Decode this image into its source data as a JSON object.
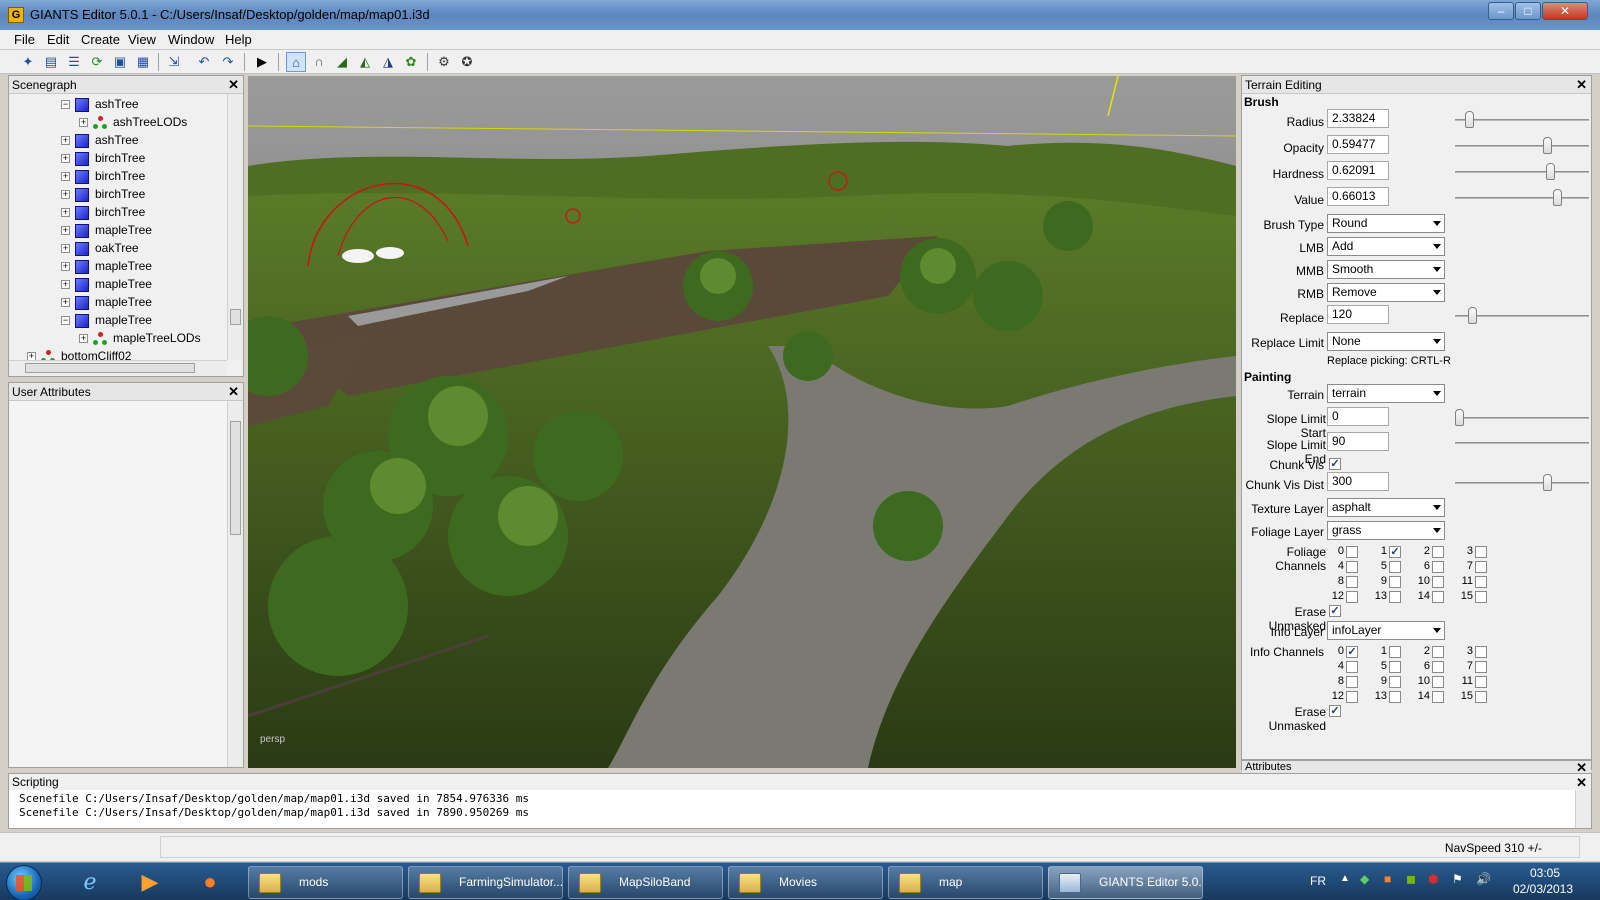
{
  "window": {
    "title": "GIANTS Editor 5.0.1 - C:/Users/Insaf/Desktop/golden/map/map01.i3d",
    "buttons": [
      "–",
      "□",
      "✕"
    ]
  },
  "menu": [
    "File",
    "Edit",
    "Create",
    "View",
    "Window",
    "Help"
  ],
  "toolbar": {
    "icons": [
      "new-icon",
      "open-icon",
      "list-icon",
      "refresh-icon",
      "save-icon",
      "save-all-icon",
      "import-icon",
      "undo-icon",
      "redo-icon",
      "play-icon",
      "select-icon",
      "move-icon",
      "terrain-sculpt-icon",
      "terrain-paint-icon",
      "terrain-texture-icon",
      "foliage-icon",
      "gear-icon",
      "gear-settings-icon"
    ]
  },
  "scenegraph": {
    "title": "Scenegraph",
    "items": [
      {
        "label": "ashTree",
        "type": "node",
        "expanded": true
      },
      {
        "label": "ashTreeLODs",
        "type": "lod",
        "expanded": false
      },
      {
        "label": "ashTree",
        "type": "node",
        "expanded": false
      },
      {
        "label": "birchTree",
        "type": "node",
        "expanded": false
      },
      {
        "label": "birchTree",
        "type": "node",
        "expanded": false
      },
      {
        "label": "birchTree",
        "type": "node",
        "expanded": false
      },
      {
        "label": "birchTree",
        "type": "node",
        "expanded": false
      },
      {
        "label": "mapleTree",
        "type": "node",
        "expanded": false
      },
      {
        "label": "oakTree",
        "type": "node",
        "expanded": false
      },
      {
        "label": "mapleTree",
        "type": "node",
        "expanded": false
      },
      {
        "label": "mapleTree",
        "type": "node",
        "expanded": false
      },
      {
        "label": "mapleTree",
        "type": "node",
        "expanded": false
      },
      {
        "label": "mapleTree",
        "type": "node",
        "expanded": true
      },
      {
        "label": "mapleTreeLODs",
        "type": "lod",
        "expanded": false
      },
      {
        "label": "bottomCliff02",
        "type": "lod",
        "expanded": false
      }
    ]
  },
  "user_attributes": {
    "title": "User Attributes"
  },
  "viewport": {
    "camera_label": "persp"
  },
  "terrain_editing": {
    "title": "Terrain Editing",
    "brush": {
      "section": "Brush",
      "radius_label": "Radius",
      "radius": "2.33824",
      "radius_level": 0.08,
      "opacity_label": "Opacity",
      "opacity": "0.59477",
      "opacity_level": 0.7,
      "hardness_label": "Hardness",
      "hardness": "0.62091",
      "hardness_level": 0.73,
      "value_label": "Value",
      "value": "0.66013",
      "value_level": 0.78,
      "brush_type_label": "Brush Type",
      "brush_type": "Round",
      "lmb_label": "LMB",
      "lmb": "Add",
      "mmb_label": "MMB",
      "mmb": "Smooth",
      "rmb_label": "RMB",
      "rmb": "Remove",
      "replace_label": "Replace",
      "replace": "120",
      "replace_level": 0.1,
      "replace_limit_label": "Replace Limit",
      "replace_limit": "None",
      "replace_picking": "Replace picking: CRTL-R"
    },
    "painting": {
      "section": "Painting",
      "terrain_label": "Terrain",
      "terrain": "terrain",
      "slope_start_label": "Slope Limit Start",
      "slope_start": "0",
      "slope_start_level": 0.0,
      "slope_end_label": "Slope Limit End",
      "slope_end": "90",
      "chunk_vis_label": "Chunk Vis",
      "chunk_vis": true,
      "chunk_vis_dist_label": "Chunk Vis Dist",
      "chunk_vis_dist": "300",
      "chunk_vis_dist_level": 0.7,
      "texture_layer_label": "Texture Layer",
      "texture_layer": "asphalt",
      "foliage_layer_label": "Foliage Layer",
      "foliage_layer": "grass",
      "foliage_channels_label": "Foliage Channels",
      "foliage_channels_checked": [
        1
      ],
      "erase_unmasked_label": "Erase Unmasked",
      "erase_unmasked": true,
      "info_layer_label": "Info Layer",
      "info_layer": "infoLayer",
      "info_channels_label": "Info Channels",
      "info_channels_checked": [
        0
      ],
      "erase_unmasked2_label": "Erase Unmasked",
      "erase_unmasked2": true
    },
    "channel_numbers": [
      "0",
      "1",
      "2",
      "3",
      "4",
      "5",
      "6",
      "7",
      "8",
      "9",
      "10",
      "11",
      "12",
      "13",
      "14",
      "15"
    ]
  },
  "attributes": {
    "title": "Attributes"
  },
  "scripting": {
    "title": "Scripting",
    "lines": [
      "Scenefile C:/Users/Insaf/Desktop/golden/map/map01.i3d saved in 7854.976336 ms",
      "Scenefile C:/Users/Insaf/Desktop/golden/map/map01.i3d saved in 7890.950269 ms"
    ]
  },
  "status": {
    "navspeed": "NavSpeed 310 +/-"
  },
  "taskbar": {
    "tasks": [
      "mods",
      "FarmingSimulator...",
      "MapSiloBand",
      "Movies",
      "map",
      "GIANTS Editor 5.0..."
    ],
    "language": "FR",
    "time": "03:05",
    "date": "02/03/2013"
  },
  "colors": {
    "accent": "#3a6ea5",
    "selection": "#cfe3fa",
    "sky": "#8a8a8a",
    "grass": "#4a6a20"
  }
}
